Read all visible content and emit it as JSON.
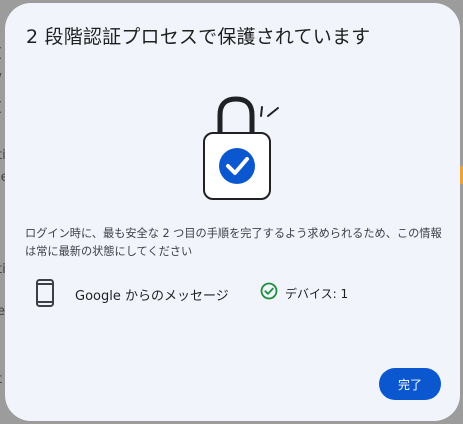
{
  "background": {
    "fragments": [
      "(",
      "/",
      "(",
      "ti",
      "ie",
      "ti",
      "e",
      "t"
    ]
  },
  "dialog": {
    "title": "2 段階認証プロセスで保護されています",
    "description": "ログイン時に、最も安全な 2 つ目の手順を完了するよう求められるため、この情報は常に最新の状態にしてください",
    "method": {
      "icon": "phone-icon",
      "sender": "Google からのメッセージ",
      "status_icon": "check-circle-icon",
      "devices_label": "デバイス: 1"
    },
    "done_label": "完了"
  },
  "colors": {
    "dialog_bg": "#f1f5fb",
    "primary": "#0b57d0",
    "success": "#1e8e3e",
    "text": "#1f1f1f"
  }
}
